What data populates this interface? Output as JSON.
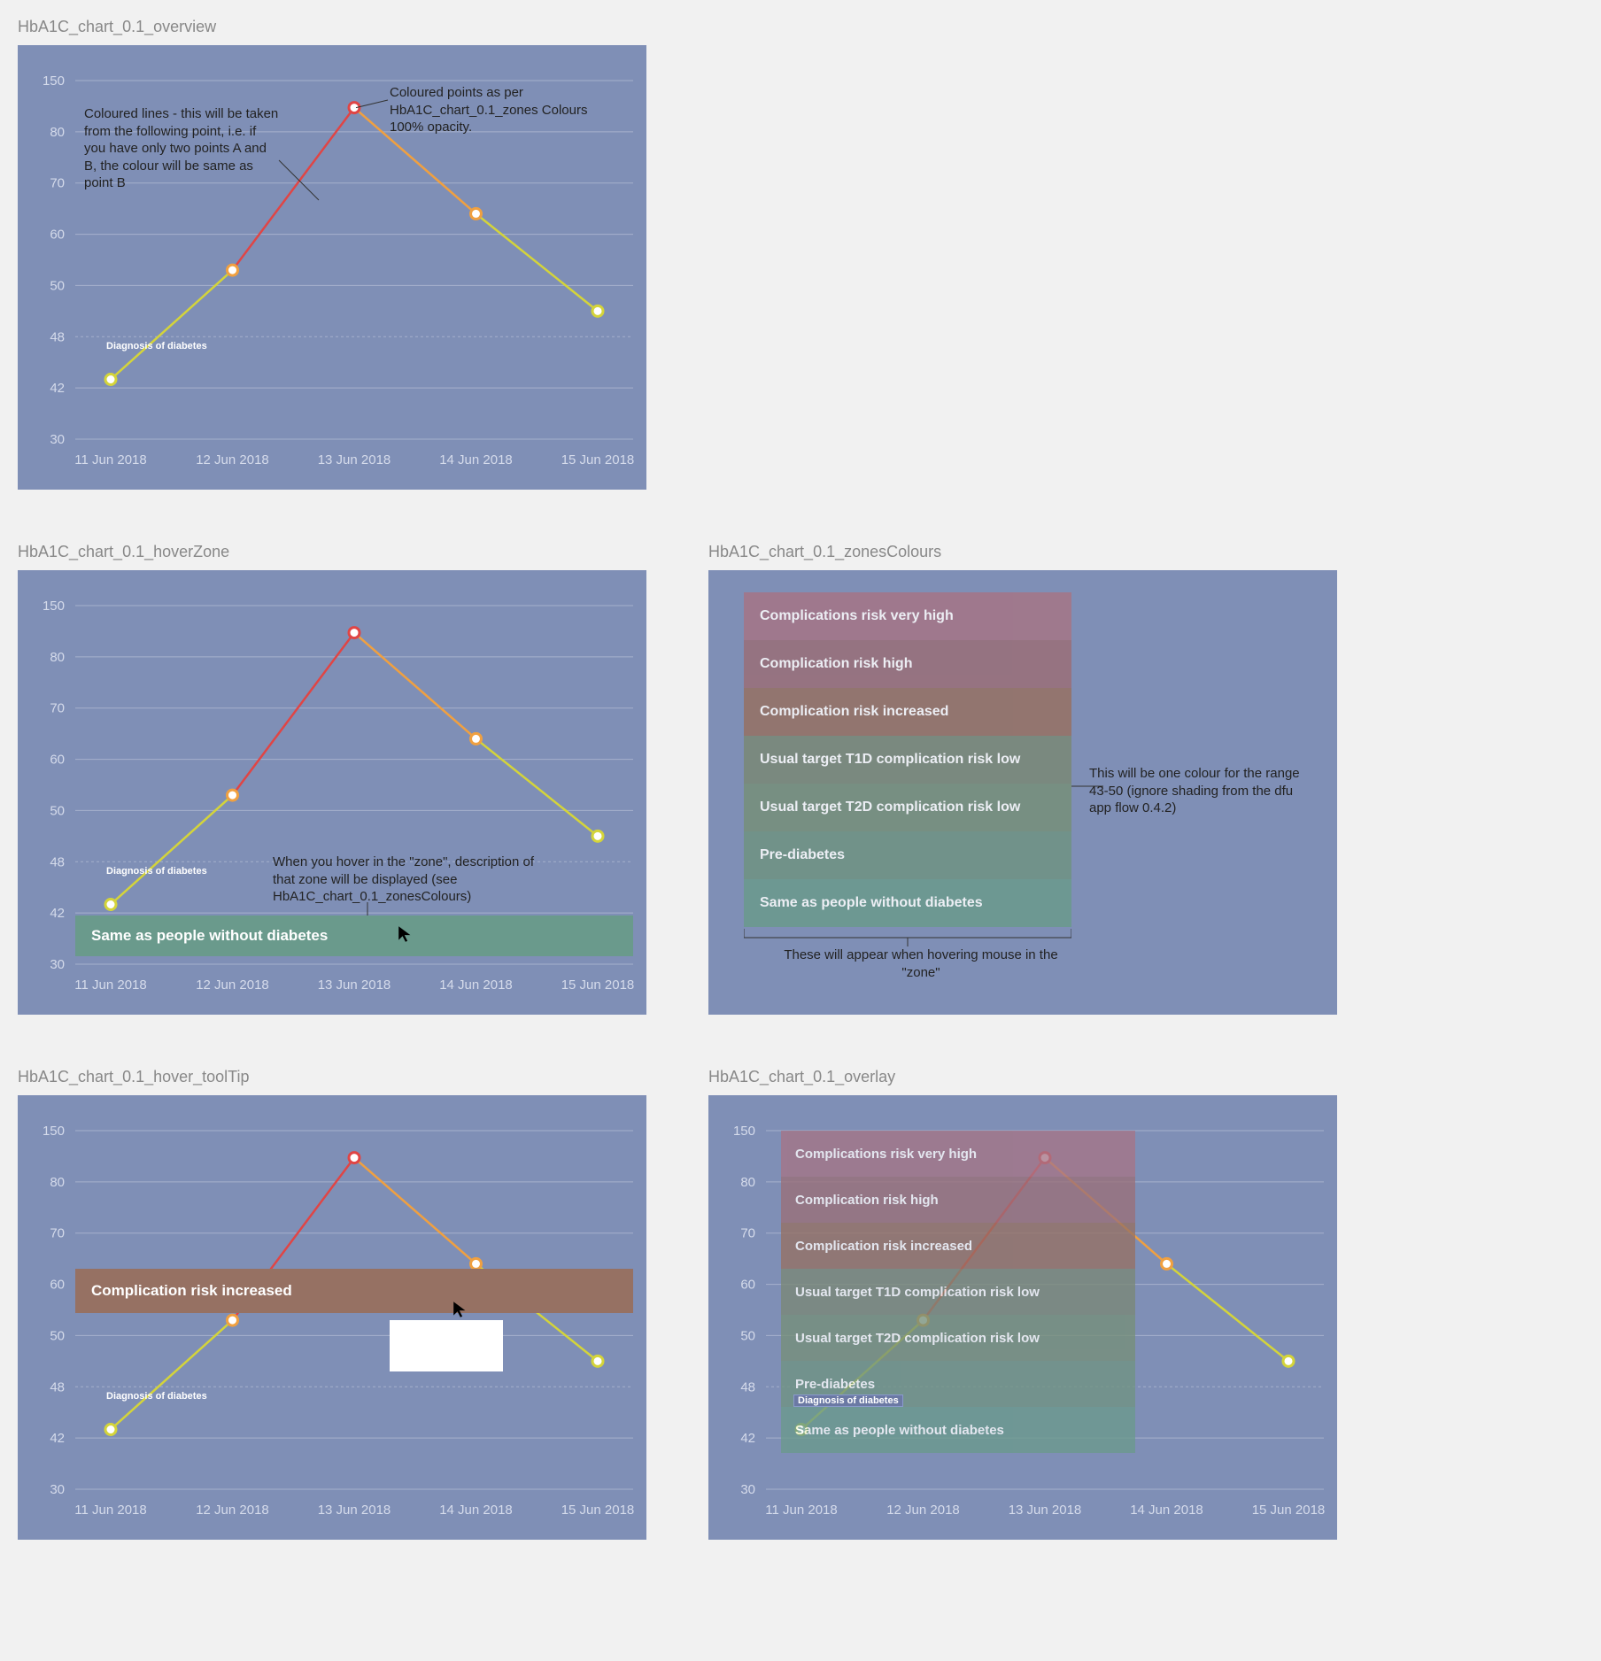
{
  "panels": {
    "overview": "HbA1C_chart_0.1_overview",
    "hoverZone": "HbA1C_chart_0.1_hoverZone",
    "zonesColours": "HbA1C_chart_0.1_zonesColours",
    "toolTip": "HbA1C_chart_0.1_hover_toolTip",
    "overlay": "HbA1C_chart_0.1_overlay"
  },
  "chart_data": {
    "type": "line",
    "categories": [
      "11 Jun 2018",
      "12 Jun 2018",
      "13 Jun 2018",
      "14 Jun 2018",
      "15 Jun 2018"
    ],
    "values": [
      43,
      53,
      113,
      64,
      49
    ],
    "y_ticks": [
      30,
      42,
      48,
      50,
      60,
      70,
      80,
      150
    ],
    "title": "",
    "xlabel": "",
    "ylabel": "",
    "reference_line": {
      "value": 48,
      "label": "Diagnosis of diabetes"
    },
    "point_colors": [
      "#d4d43a",
      "#f0a040",
      "#e04545",
      "#f0a040",
      "#d4d43a"
    ],
    "segment_colors": [
      "#d4d43a",
      "#e04545",
      "#f0a040",
      "#d4d43a"
    ]
  },
  "annotations": {
    "coloured_lines": "Coloured lines - this will be taken from the following point, i.e. if you have only two points A and B, the colour will be same as point B",
    "coloured_points": "Coloured points as per HbA1C_chart_0.1_zones Colours 100% opacity.",
    "hover_zone": "When you hover in the \"zone\", description of that zone will be displayed (see HbA1C_chart_0.1_zonesColours)",
    "zones_right": "This will be one colour for the range 43-50 (ignore shading from the dfu app flow 0.4.2)",
    "zones_bottom": "These will appear when hovering mouse in the \"zone\""
  },
  "zones": [
    {
      "label": "Complications risk very high",
      "color": "#a57586"
    },
    {
      "label": "Complication risk high",
      "color": "#9a6f78"
    },
    {
      "label": "Complication risk increased",
      "color": "#967163"
    },
    {
      "label": "Usual target T1D complication risk low",
      "color": "#7a8876"
    },
    {
      "label": "Usual target T2D complication risk low",
      "color": "#768f79"
    },
    {
      "label": "Pre-diabetes",
      "color": "#6f9382"
    },
    {
      "label": "Same as people without diabetes",
      "color": "#6a9a8c"
    }
  ],
  "hover_band_label": "Same as people without diabetes",
  "tooltip_band_label": "Complication risk increased",
  "diagnosis_label": "Diagnosis of diabetes",
  "colors": {
    "chart_bg": "#7f8fb6",
    "grid": "#a6b0cc",
    "axis_text": "#d5dbeb",
    "zone_green": "#6a9a8c",
    "zone_brown": "#967163"
  }
}
